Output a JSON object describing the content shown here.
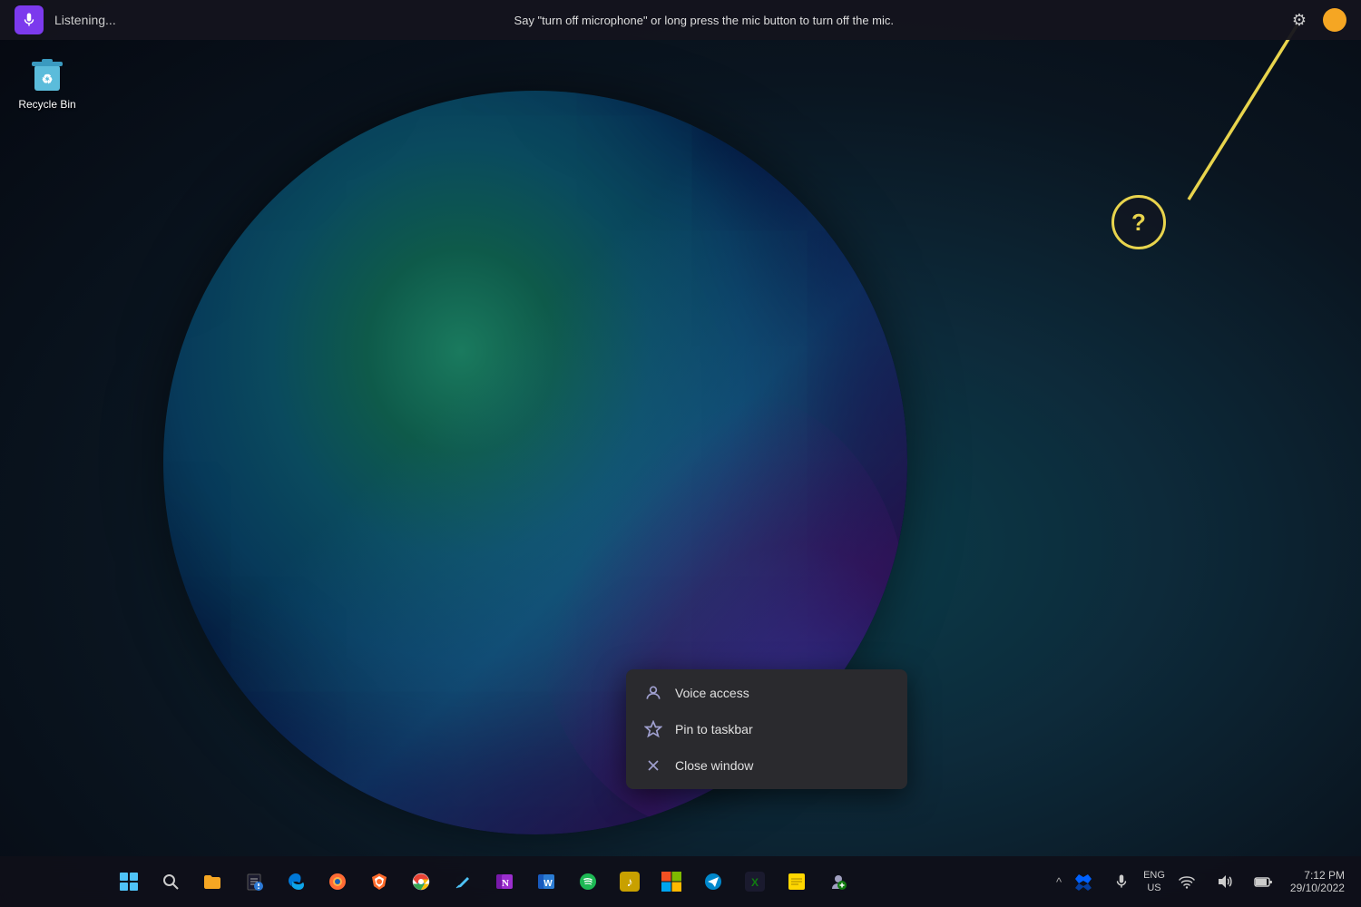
{
  "desktop": {
    "icons": [
      {
        "id": "recycle-bin",
        "label": "Recycle Bin"
      }
    ]
  },
  "voice_toolbar": {
    "listening_label": "Listening...",
    "instruction": "Say \"turn off microphone\" or long press the mic button to turn off the mic."
  },
  "help_button": {
    "symbol": "?"
  },
  "context_menu": {
    "items": [
      {
        "id": "voice-access",
        "label": "Voice access",
        "icon": "👤"
      },
      {
        "id": "pin-taskbar",
        "label": "Pin to taskbar",
        "icon": "☆"
      },
      {
        "id": "close-window",
        "label": "Close window",
        "icon": "✕"
      }
    ]
  },
  "taskbar": {
    "center_icons": [
      {
        "id": "start",
        "icon": "⊞",
        "label": "Start"
      },
      {
        "id": "search",
        "icon": "🔍",
        "label": "Search"
      },
      {
        "id": "file-explorer",
        "icon": "📁",
        "label": "File Explorer"
      },
      {
        "id": "notepad",
        "icon": "📝",
        "label": "Notepad"
      },
      {
        "id": "edge",
        "icon": "🌐",
        "label": "Edge"
      },
      {
        "id": "firefox",
        "icon": "🦊",
        "label": "Firefox"
      },
      {
        "id": "brave",
        "icon": "🦁",
        "label": "Brave"
      },
      {
        "id": "chrome",
        "icon": "◎",
        "label": "Chrome"
      },
      {
        "id": "pen",
        "icon": "✏️",
        "label": "Pen"
      },
      {
        "id": "onenote",
        "icon": "📓",
        "label": "OneNote"
      },
      {
        "id": "word",
        "icon": "W",
        "label": "Word"
      },
      {
        "id": "spotify",
        "icon": "♪",
        "label": "Spotify"
      },
      {
        "id": "app1",
        "icon": "🎵",
        "label": "App"
      },
      {
        "id": "ms-store",
        "icon": "🛍",
        "label": "Microsoft Store"
      },
      {
        "id": "telegram",
        "icon": "✈",
        "label": "Telegram"
      },
      {
        "id": "xbox",
        "icon": "🎮",
        "label": "Xbox"
      },
      {
        "id": "notes",
        "icon": "📋",
        "label": "Notes"
      },
      {
        "id": "people",
        "icon": "👤",
        "label": "People"
      }
    ],
    "tray": {
      "chevron": "^",
      "dropbox": "◈",
      "mic": "🎤",
      "lang_top": "ENG",
      "lang_bottom": "US",
      "wifi": "📶",
      "volume": "🔊",
      "battery": "🔋",
      "time": "7:12 PM",
      "date": "29/10/2022"
    }
  }
}
